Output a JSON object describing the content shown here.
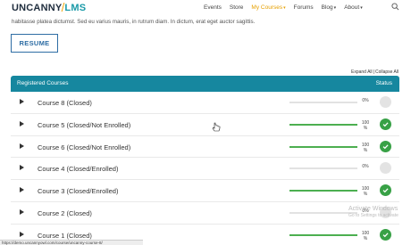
{
  "header": {
    "logo_part1": "UNCANNY",
    "logo_part2": "LMS",
    "nav": [
      {
        "label": "Events",
        "dropdown": false
      },
      {
        "label": "Store",
        "dropdown": false
      },
      {
        "label": "My Courses",
        "dropdown": true,
        "active": true
      },
      {
        "label": "Forums",
        "dropdown": false
      },
      {
        "label": "Blog",
        "dropdown": true
      },
      {
        "label": "About",
        "dropdown": true
      }
    ]
  },
  "intro_text": "habitasse platea dictumst. Sed eu varius mauris, in rutrum diam. In dictum, erat eget auctor sagittis.",
  "resume_label": "RESUME",
  "expand_all": "Expand All",
  "collapse_all": "Collapse All",
  "table": {
    "title": "Registered Courses",
    "status_label": "Status",
    "rows": [
      {
        "title": "Course 8 (Closed)",
        "percent": "0%",
        "progress": 0,
        "completed": false
      },
      {
        "title": "Course 5 (Closed/Not Enrolled)",
        "percent": "100 %",
        "progress": 100,
        "completed": true
      },
      {
        "title": "Course 6 (Closed/Not Enrolled)",
        "percent": "100 %",
        "progress": 100,
        "completed": true
      },
      {
        "title": "Course 4 (Closed/Enrolled)",
        "percent": "0%",
        "progress": 0,
        "completed": false
      },
      {
        "title": "Course 3 (Closed/Enrolled)",
        "percent": "100 %",
        "progress": 100,
        "completed": true
      },
      {
        "title": "Course 2 (Closed)",
        "percent": "0%",
        "progress": 0,
        "completed": false
      },
      {
        "title": "Course 1 (Closed)",
        "percent": "100 %",
        "progress": 100,
        "completed": true
      }
    ]
  },
  "watermark": {
    "title": "Activate Windows",
    "subtitle": "Go to Settings to activate"
  },
  "status_url": "https://demo.uncannyowl.com/course/uncanny-course-8/",
  "colors": {
    "accent": "#16879f",
    "nav_active": "#e6a000",
    "complete": "#38a146",
    "button": "#2e6da4"
  }
}
